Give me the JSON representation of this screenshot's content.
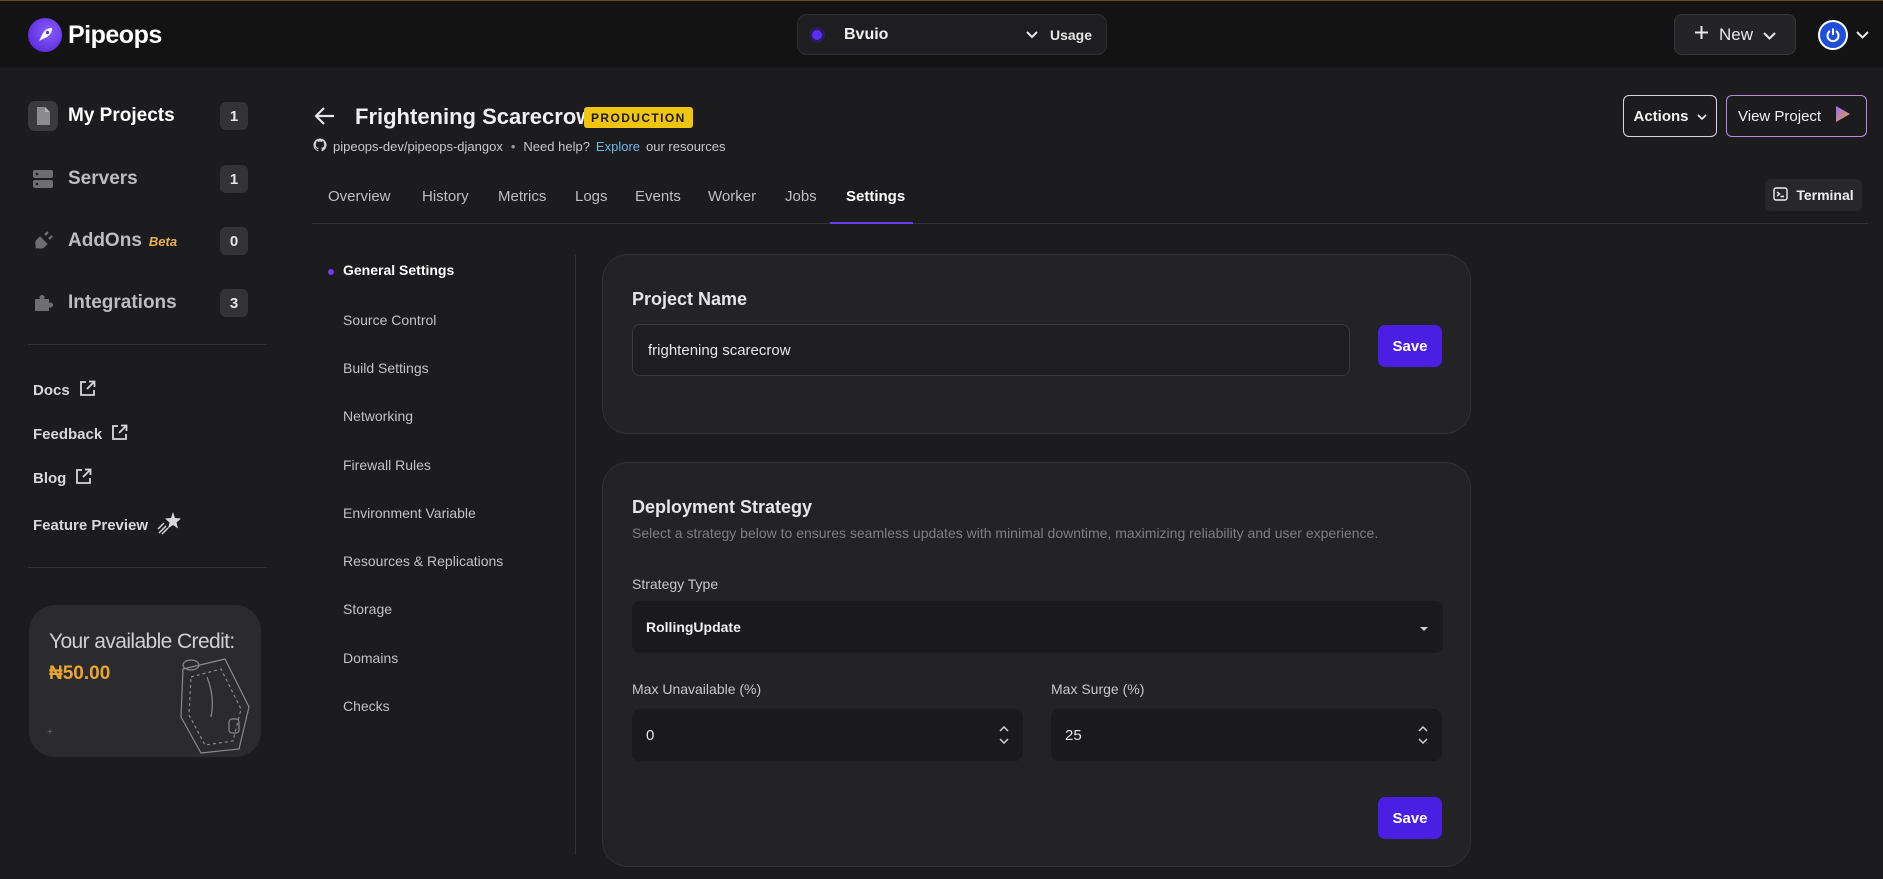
{
  "brand": {
    "name": "Pipeops"
  },
  "topbar": {
    "org_name": "Bvuio",
    "usage_label": "Usage",
    "new_label": "New"
  },
  "sidebar": {
    "items": [
      {
        "label": "My Projects",
        "count": "1",
        "icon": "file-icon",
        "active": true
      },
      {
        "label": "Servers",
        "count": "1",
        "icon": "server-icon"
      },
      {
        "label": "AddOns",
        "badge": "Beta",
        "count": "0",
        "icon": "plug-icon"
      },
      {
        "label": "Integrations",
        "count": "3",
        "icon": "puzzle-icon"
      }
    ],
    "links": [
      {
        "label": "Docs",
        "icon": "external-link-icon"
      },
      {
        "label": "Feedback",
        "icon": "external-link-icon"
      },
      {
        "label": "Blog",
        "icon": "external-link-icon"
      },
      {
        "label": "Feature Preview",
        "icon": "sparkle-star-icon"
      }
    ],
    "credit": {
      "title": "Your available Credit:",
      "amount": "₦50.00",
      "plus": "+"
    }
  },
  "project": {
    "title": "Frightening Scarecrow",
    "environment": "PRODUCTION",
    "repo": "pipeops-dev/pipeops-djangox",
    "separator": "•",
    "help_prefix": "Need help?",
    "help_link": "Explore",
    "help_suffix": "our resources",
    "actions_label": "Actions",
    "view_label": "View Project"
  },
  "tabs": [
    {
      "label": "Overview"
    },
    {
      "label": "History"
    },
    {
      "label": "Metrics"
    },
    {
      "label": "Logs"
    },
    {
      "label": "Events"
    },
    {
      "label": "Worker"
    },
    {
      "label": "Jobs"
    },
    {
      "label": "Settings",
      "active": true
    }
  ],
  "terminal_label": "Terminal",
  "settings_nav": [
    {
      "label": "General Settings",
      "active": true
    },
    {
      "label": "Source Control"
    },
    {
      "label": "Build Settings"
    },
    {
      "label": "Networking"
    },
    {
      "label": "Firewall Rules"
    },
    {
      "label": "Environment Variable"
    },
    {
      "label": "Resources & Replications"
    },
    {
      "label": "Storage"
    },
    {
      "label": "Domains"
    },
    {
      "label": "Checks"
    }
  ],
  "project_name_card": {
    "title": "Project Name",
    "value": "frightening scarecrow",
    "save_label": "Save"
  },
  "deployment_card": {
    "title": "Deployment Strategy",
    "description": "Select a strategy below to ensures seamless updates with minimal downtime, maximizing reliability and user experience.",
    "strategy_label": "Strategy Type",
    "strategy_value": "RollingUpdate",
    "max_unavailable_label": "Max Unavailable (%)",
    "max_unavailable_value": "0",
    "max_surge_label": "Max Surge (%)",
    "max_surge_value": "25",
    "save_label": "Save"
  },
  "colors": {
    "accent": "#4a1fe3",
    "badge": "#f1c40f",
    "credit": "#e9a531",
    "background": "#1c1c1e"
  }
}
